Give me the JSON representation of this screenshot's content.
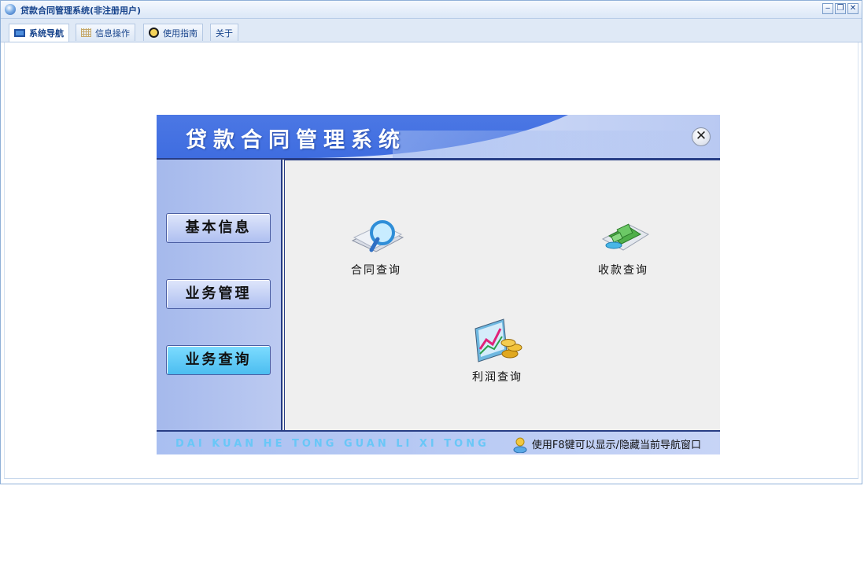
{
  "window": {
    "title": "贷款合同管理系统(非注册用户)",
    "buttons": [
      "‒",
      "❐",
      "✕"
    ]
  },
  "tabs": [
    {
      "label": "系统导航",
      "icon": "monitor-icon",
      "active": true
    },
    {
      "label": "信息操作",
      "icon": "grid-icon",
      "active": false
    },
    {
      "label": "使用指南",
      "icon": "bulb-icon",
      "active": false
    },
    {
      "label": "关于",
      "icon": "",
      "active": false
    }
  ],
  "panel": {
    "title": "贷款合同管理系统",
    "close_icon": "✕",
    "sidebar": [
      {
        "label": "基本信息",
        "active": false
      },
      {
        "label": "业务管理",
        "active": false
      },
      {
        "label": "业务查询",
        "active": true
      }
    ],
    "queries": [
      {
        "label": "合同查询",
        "icon": "contract-search-icon"
      },
      {
        "label": "收款查询",
        "icon": "payment-search-icon"
      },
      {
        "label": "利润查询",
        "icon": "profit-search-icon"
      }
    ],
    "footer": {
      "pinyin": "DAI KUAN HE TONG GUAN LI XI TONG",
      "hint": "使用F8键可以显示/隐藏当前导航窗口"
    }
  },
  "colors": {
    "accent": "#273d85",
    "active_nav": "#5cc8f5",
    "banner": "#4f78e6"
  }
}
